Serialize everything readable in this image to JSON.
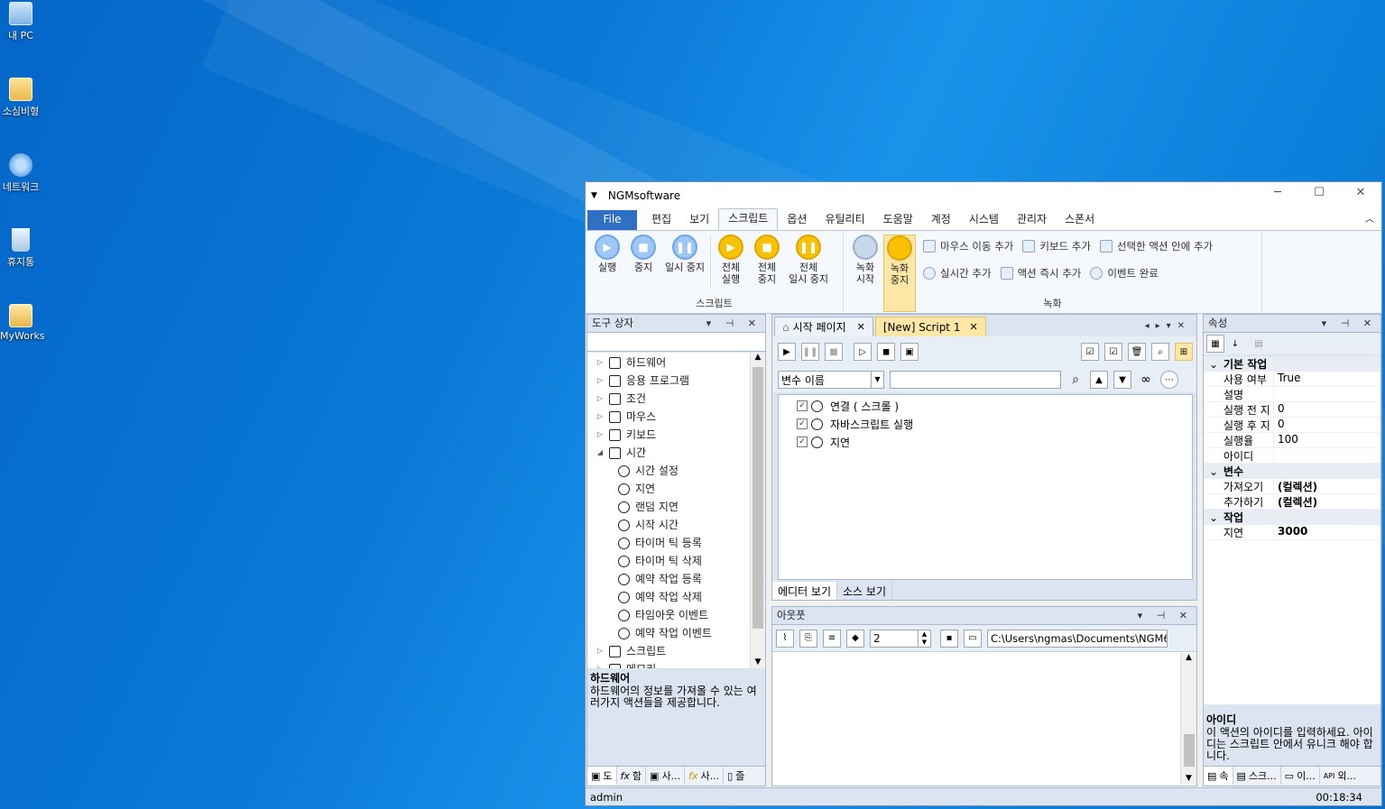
{
  "desktop": {
    "icons": [
      {
        "label": "내 PC",
        "icon": "computer-icon"
      },
      {
        "label": "소심비형",
        "icon": "user-folder-icon"
      },
      {
        "label": "네트워크",
        "icon": "network-icon"
      },
      {
        "label": "휴지통",
        "icon": "recycle-bin-icon"
      },
      {
        "label": "MyWorks",
        "icon": "folder-icon"
      }
    ]
  },
  "window": {
    "title": "NGMsoftware",
    "menu": [
      "File",
      "편집",
      "보기",
      "스크립트",
      "옵션",
      "유틸리티",
      "도움말",
      "계정",
      "시스템",
      "관리자",
      "스폰서"
    ],
    "selected_menu": "스크립트"
  },
  "ribbon": {
    "script_group": {
      "label": "스크립트",
      "buttons": [
        {
          "label": "실행",
          "icon": "play-icon"
        },
        {
          "label": "중지",
          "icon": "stop-icon"
        },
        {
          "label": "일시 중지",
          "icon": "pause-icon"
        },
        {
          "label": "전체\n실행",
          "icon": "play-all-icon"
        },
        {
          "label": "전체\n중지",
          "icon": "stop-all-icon"
        },
        {
          "label": "전체\n일시 중지",
          "icon": "pause-all-icon"
        }
      ]
    },
    "record_group": {
      "label": "녹화",
      "buttons": [
        {
          "label": "녹화\n시작",
          "icon": "record-start-icon"
        },
        {
          "label": "녹화\n중지",
          "icon": "record-stop-icon"
        }
      ],
      "small_items": [
        {
          "label": "마우스 이동 추가",
          "icon": "mouse-move-icon"
        },
        {
          "label": "키보드 추가",
          "icon": "keyboard-icon"
        },
        {
          "label": "선택한 액션 안에 추가",
          "icon": "tree-add-icon"
        },
        {
          "label": "실시간 추가",
          "icon": "realtime-icon"
        },
        {
          "label": "액션 즉시 추가",
          "icon": "action-add-icon"
        },
        {
          "label": "이벤트 완료",
          "icon": "event-done-icon"
        }
      ]
    }
  },
  "toolbox": {
    "title": "도구 상자",
    "items": [
      {
        "label": "하드웨어",
        "level": 0,
        "expand": "▷",
        "icon": "laptop-icon"
      },
      {
        "label": "응용 프로그램",
        "level": 0,
        "expand": "▷",
        "icon": "terminal-icon"
      },
      {
        "label": "조건",
        "level": 0,
        "expand": "▷",
        "icon": "condition-icon"
      },
      {
        "label": "마우스",
        "level": 0,
        "expand": "▷",
        "icon": "mouse-icon"
      },
      {
        "label": "키보드",
        "level": 0,
        "expand": "▷",
        "icon": "keyboard-icon"
      },
      {
        "label": "시간",
        "level": 0,
        "expand": "◢",
        "icon": "alarm-clock-icon"
      },
      {
        "label": "시간 설정",
        "level": 1,
        "expand": "",
        "icon": "clock-icon"
      },
      {
        "label": "지연",
        "level": 1,
        "expand": "",
        "icon": "stopwatch-icon"
      },
      {
        "label": "랜덤 지연",
        "level": 1,
        "expand": "",
        "icon": "random-timer-icon"
      },
      {
        "label": "시작 시간",
        "level": 1,
        "expand": "",
        "icon": "start-time-icon"
      },
      {
        "label": "타이머 틱 등록",
        "level": 1,
        "expand": "",
        "icon": "timer-add-icon"
      },
      {
        "label": "타이머 틱 삭제",
        "level": 1,
        "expand": "",
        "icon": "timer-remove-icon"
      },
      {
        "label": "예약 작업 등록",
        "level": 1,
        "expand": "",
        "icon": "schedule-add-icon"
      },
      {
        "label": "예약 작업 삭제",
        "level": 1,
        "expand": "",
        "icon": "schedule-remove-icon"
      },
      {
        "label": "타임아웃 이벤트",
        "level": 1,
        "expand": "",
        "icon": "bolt-icon"
      },
      {
        "label": "예약 작업 이벤트",
        "level": 1,
        "expand": "",
        "icon": "bolt-icon"
      },
      {
        "label": "스크립트",
        "level": 0,
        "expand": "▷",
        "icon": "script-icon"
      },
      {
        "label": "메모리",
        "level": 0,
        "expand": "▷",
        "icon": "memory-icon"
      }
    ],
    "desc_title": "하드웨어",
    "desc_text": "하드웨어의 정보를 가져올 수 있는 여러가지 액션들을 제공합니다.",
    "bottom_tabs": [
      "도",
      "함",
      "사...",
      "사...",
      "즐"
    ]
  },
  "editor": {
    "tabs": [
      {
        "label": "시작 페이지",
        "active": false
      },
      {
        "label": "[New] Script 1",
        "active": true
      }
    ],
    "var_combo": "변수 이름",
    "actions": [
      {
        "label": "연결 ( 스크롤 )",
        "icon": "link-icon",
        "checked": true
      },
      {
        "label": "자바스크립트 실행",
        "icon": "javascript-icon",
        "checked": true
      },
      {
        "label": "지연",
        "icon": "stopwatch-icon",
        "checked": true
      }
    ],
    "view_tabs": [
      "에디터 보기",
      "소스 보기"
    ]
  },
  "output": {
    "title": "아웃풋",
    "count": "2",
    "path": "C:\\Users\\ngmas\\Documents\\NGM6\\"
  },
  "properties": {
    "title": "속성",
    "categories": [
      {
        "name": "기본 작업",
        "rows": [
          {
            "key": "사용 여부",
            "value": "True",
            "bold": false
          },
          {
            "key": "설명",
            "value": "",
            "bold": false
          },
          {
            "key": "실행 전 지",
            "value": "0",
            "bold": false
          },
          {
            "key": "실행 후 지",
            "value": "0",
            "bold": false
          },
          {
            "key": "실행율",
            "value": "100",
            "bold": false
          },
          {
            "key": "아이디",
            "value": "",
            "bold": false
          }
        ]
      },
      {
        "name": "변수",
        "rows": [
          {
            "key": "가져오기",
            "value": "(컬렉션)",
            "bold": true
          },
          {
            "key": "추가하기",
            "value": "(컬렉션)",
            "bold": true
          }
        ]
      },
      {
        "name": "작업",
        "rows": [
          {
            "key": "지연",
            "value": "3000",
            "bold": true
          }
        ]
      }
    ],
    "desc_title": "아이디",
    "desc_text": "이 액션의 아이디를 입력하세요. 아이디는 스크립트 안에서 유니크 해야 합니다.",
    "bottom_tabs": [
      "속",
      "스크...",
      "이...",
      "외..."
    ]
  },
  "statusbar": {
    "user": "admin",
    "time": "00:18:34"
  }
}
